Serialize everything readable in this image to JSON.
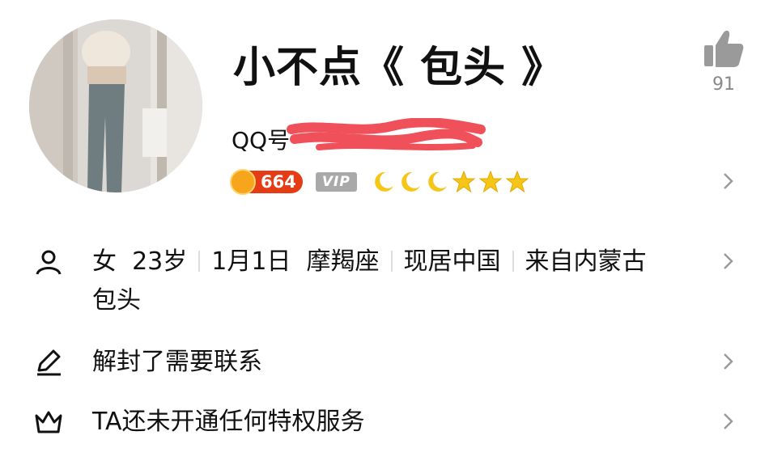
{
  "profile": {
    "nickname": "小不点《 包头 》",
    "qq_label": "QQ号",
    "qq_number_visible": "",
    "likes": "91",
    "coin_score": "664",
    "vip_label": "VIP",
    "level_icons": [
      "moon",
      "moon",
      "moon",
      "star",
      "star",
      "star"
    ]
  },
  "info": {
    "gender": "女",
    "age": "23岁",
    "birthday": "1月1日",
    "zodiac": "摩羯座",
    "location": "现居中国",
    "hometown": "来自内蒙古",
    "hometown_cont": "包头"
  },
  "signature": "解封了需要联系",
  "privilege": "TA还未开通任何特权服务",
  "colors": {
    "redact": "#f0505a",
    "coin_bg": "#e63c16",
    "coin": "#f7a51c",
    "level": "#f5c518",
    "muted": "#888888"
  },
  "icons": {
    "like": "thumbs-up-icon",
    "person": "person-icon",
    "edit": "pencil-icon",
    "crown": "crown-icon",
    "chevron": "chevron-right-icon"
  }
}
